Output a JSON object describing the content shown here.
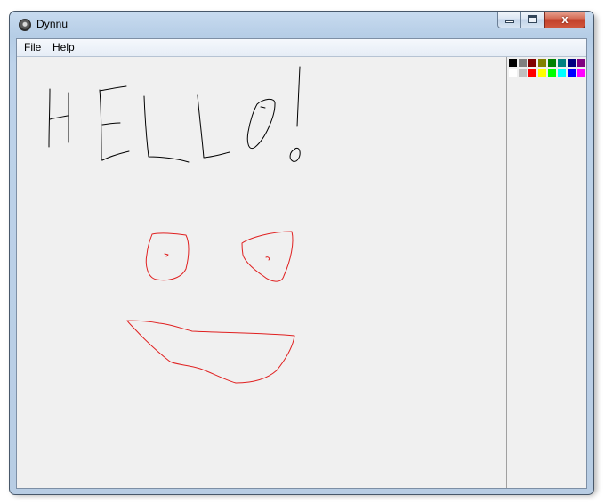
{
  "window": {
    "title": "Dynnu",
    "app_icon": "app-icon",
    "controls": {
      "minimize": "minimize-icon",
      "maximize": "maximize-icon",
      "close_glyph": "x"
    }
  },
  "menu": {
    "items": [
      {
        "label": "File"
      },
      {
        "label": "Help"
      }
    ]
  },
  "canvas": {
    "background": "#f0f0f0",
    "strokes": [
      {
        "name": "hello-text-drawing",
        "color": "#000000"
      },
      {
        "name": "left-eye-drawing",
        "color": "#e02020"
      },
      {
        "name": "right-eye-drawing",
        "color": "#e02020"
      },
      {
        "name": "mouth-drawing",
        "color": "#e02020"
      }
    ]
  },
  "palette": {
    "colors": [
      "#000000",
      "#808080",
      "#800000",
      "#808000",
      "#008000",
      "#008080",
      "#000080",
      "#800080",
      "#ffffff",
      "#c0c0c0",
      "#ff0000",
      "#ffff00",
      "#00ff00",
      "#00ffff",
      "#0000ff",
      "#ff00ff"
    ]
  }
}
